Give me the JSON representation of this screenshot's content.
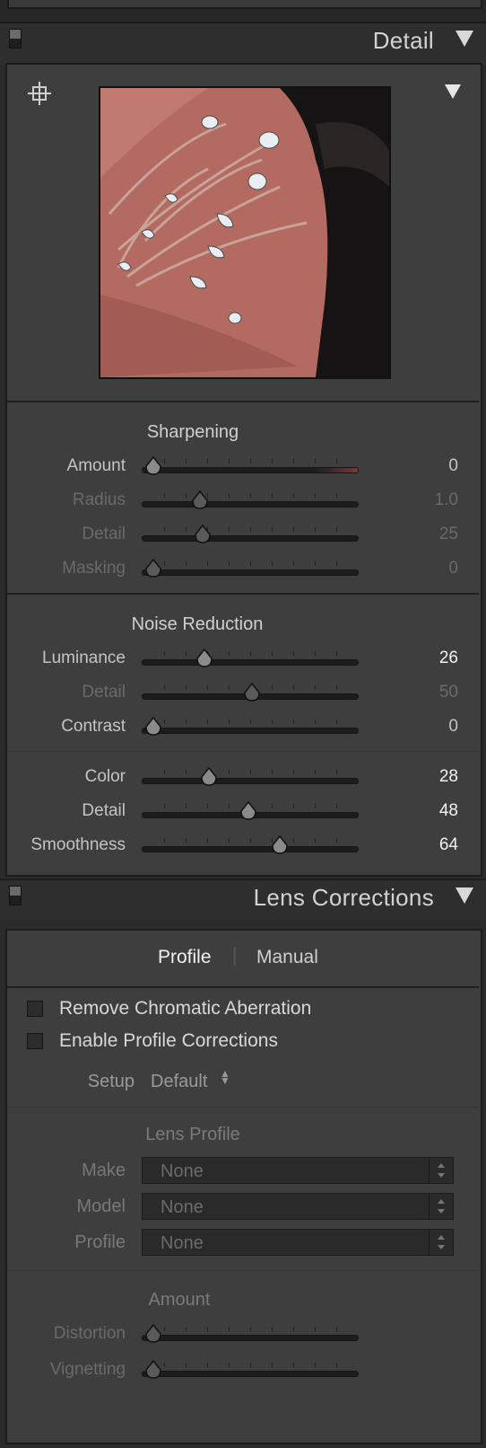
{
  "detail": {
    "title": "Detail",
    "sharpening": {
      "title": "Sharpening",
      "rows": [
        {
          "label": "Amount",
          "value": "0",
          "level": 0,
          "state": "active"
        },
        {
          "label": "Radius",
          "value": "1.0",
          "level": 0.235,
          "state": "dim"
        },
        {
          "label": "Detail",
          "value": "25",
          "level": 0.25,
          "state": "dim"
        },
        {
          "label": "Masking",
          "value": "0",
          "level": 0,
          "state": "dim"
        }
      ]
    },
    "noise": {
      "title": "Noise Reduction",
      "rows": [
        {
          "label": "Luminance",
          "value": "26",
          "level": 0.26,
          "state": "lit"
        },
        {
          "label": "Detail",
          "value": "50",
          "level": 0.5,
          "state": "dim"
        },
        {
          "label": "Contrast",
          "value": "0",
          "level": 0,
          "state": "mid"
        },
        {
          "label": "Color",
          "value": "28",
          "level": 0.28,
          "state": "lit"
        },
        {
          "label": "Detail",
          "value": "48",
          "level": 0.48,
          "state": "lit"
        },
        {
          "label": "Smoothness",
          "value": "64",
          "level": 0.64,
          "state": "lit"
        }
      ]
    }
  },
  "lens": {
    "title": "Lens Corrections",
    "tabs": {
      "profile": "Profile",
      "manual": "Manual",
      "separator": "|"
    },
    "remove_ca": "Remove Chromatic Aberration",
    "enable_profile": "Enable Profile Corrections",
    "setup_label": "Setup",
    "setup_value": "Default",
    "lens_profile_title": "Lens Profile",
    "make_label": "Make",
    "make_value": "None",
    "model_label": "Model",
    "model_value": "None",
    "profile_label": "Profile",
    "profile_value": "None",
    "amount_title": "Amount",
    "distortion_label": "Distortion",
    "distortion_level": 0,
    "vignetting_label": "Vignetting",
    "vignetting_level": 0
  },
  "colors": {
    "amount_track_accent": "#7a3a36",
    "panel_bg": "#3e3e3e",
    "header_bg": "#2e2e2e"
  }
}
